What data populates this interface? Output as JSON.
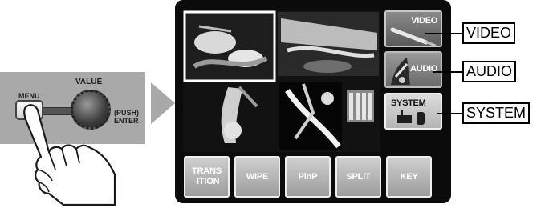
{
  "panel": {
    "value_label": "VALUE",
    "menu_label": "MENU",
    "knob_label_line1": "(PUSH)",
    "knob_label_line2": "ENTER"
  },
  "screen": {
    "side_buttons": [
      {
        "label": "VIDEO"
      },
      {
        "label": "AUDIO"
      },
      {
        "label": "SYSTEM"
      }
    ],
    "bottom_buttons": [
      {
        "label": "TRANS\n-ITION"
      },
      {
        "label": "WIPE"
      },
      {
        "label": "PinP"
      },
      {
        "label": "SPLIT"
      },
      {
        "label": "KEY"
      }
    ]
  },
  "callouts": {
    "video": "VIDEO",
    "audio": "AUDIO",
    "system": "SYSTEM"
  },
  "colors": {
    "panel": "#a9a9a9",
    "screen": "#0b0b0b",
    "arrow": "#a8a8a8"
  }
}
